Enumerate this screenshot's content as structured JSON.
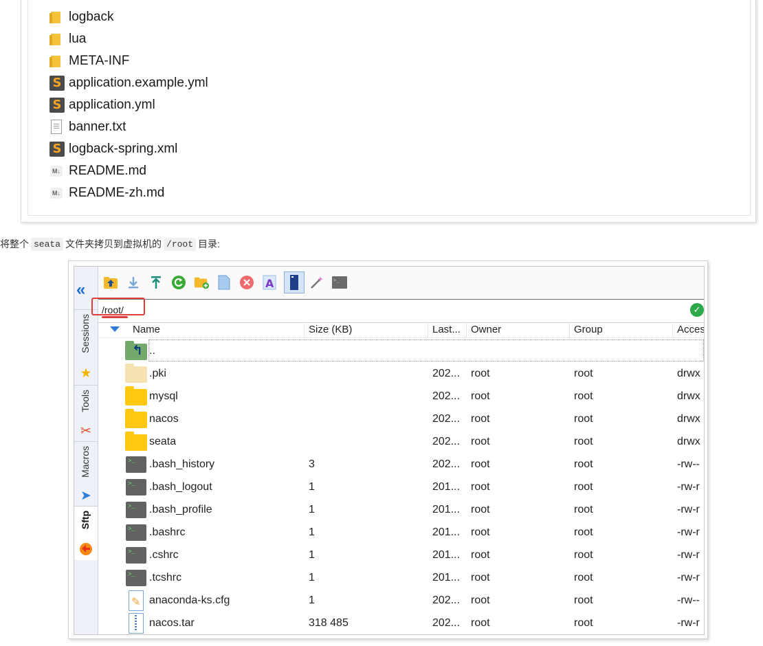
{
  "explorer": {
    "files": [
      {
        "name": "logback",
        "icon": "folder-icon"
      },
      {
        "name": "lua",
        "icon": "folder-icon"
      },
      {
        "name": "META-INF",
        "icon": "folder-icon"
      },
      {
        "name": "application.example.yml",
        "icon": "sublime-file-icon"
      },
      {
        "name": "application.yml",
        "icon": "sublime-file-icon"
      },
      {
        "name": "banner.txt",
        "icon": "text-file-icon"
      },
      {
        "name": "logback-spring.xml",
        "icon": "sublime-file-icon"
      },
      {
        "name": "README.md",
        "icon": "markdown-file-icon"
      },
      {
        "name": "README-zh.md",
        "icon": "markdown-file-icon"
      }
    ]
  },
  "caption": {
    "part1": "将整个",
    "code1": "seata",
    "part2": "文件夹拷贝到虚拟机的",
    "code2": "/root",
    "part3": "目录:"
  },
  "sidebar": {
    "tabs": [
      {
        "label": "Sessions",
        "icon": "star-icon"
      },
      {
        "label": "Tools",
        "icon": "tools-icon"
      },
      {
        "label": "Macros",
        "icon": "paper-plane-icon"
      },
      {
        "label": "Sftp",
        "icon": "sftp-icon",
        "active": true
      }
    ]
  },
  "toolbar": {
    "buttons": [
      "parent-folder-icon",
      "download-icon",
      "upload-icon",
      "refresh-icon",
      "new-folder-icon",
      "new-file-icon",
      "delete-icon",
      "rename-icon",
      "toggle-panel-icon",
      "magic-wand-icon",
      "terminal-icon"
    ]
  },
  "path": {
    "value": "/root/"
  },
  "columns": {
    "name": "Name",
    "size": "Size (KB)",
    "last": "Last...",
    "owner": "Owner",
    "group": "Group",
    "access": "Access"
  },
  "rows": [
    {
      "name": "..",
      "size": "",
      "last": "",
      "owner": "",
      "group": "",
      "access": "",
      "kind": "up"
    },
    {
      "name": ".pki",
      "size": "",
      "last": "202...",
      "owner": "root",
      "group": "root",
      "access": "drwx",
      "kind": "dir-pale"
    },
    {
      "name": "mysql",
      "size": "",
      "last": "202...",
      "owner": "root",
      "group": "root",
      "access": "drwx",
      "kind": "dir"
    },
    {
      "name": "nacos",
      "size": "",
      "last": "202...",
      "owner": "root",
      "group": "root",
      "access": "drwx",
      "kind": "dir"
    },
    {
      "name": "seata",
      "size": "",
      "last": "202...",
      "owner": "root",
      "group": "root",
      "access": "drwx",
      "kind": "dir"
    },
    {
      "name": ".bash_history",
      "size": "3",
      "last": "202...",
      "owner": "root",
      "group": "root",
      "access": "-rw--",
      "kind": "term"
    },
    {
      "name": ".bash_logout",
      "size": "1",
      "last": "201...",
      "owner": "root",
      "group": "root",
      "access": "-rw-r",
      "kind": "term"
    },
    {
      "name": ".bash_profile",
      "size": "1",
      "last": "201...",
      "owner": "root",
      "group": "root",
      "access": "-rw-r",
      "kind": "term"
    },
    {
      "name": ".bashrc",
      "size": "1",
      "last": "201...",
      "owner": "root",
      "group": "root",
      "access": "-rw-r",
      "kind": "term"
    },
    {
      "name": ".cshrc",
      "size": "1",
      "last": "201...",
      "owner": "root",
      "group": "root",
      "access": "-rw-r",
      "kind": "term"
    },
    {
      "name": ".tcshrc",
      "size": "1",
      "last": "201...",
      "owner": "root",
      "group": "root",
      "access": "-rw-r",
      "kind": "term"
    },
    {
      "name": "anaconda-ks.cfg",
      "size": "1",
      "last": "202...",
      "owner": "root",
      "group": "root",
      "access": "-rw--",
      "kind": "cfg"
    },
    {
      "name": "nacos.tar",
      "size": "318 485",
      "last": "202...",
      "owner": "root",
      "group": "root",
      "access": "-rw-r",
      "kind": "zip"
    }
  ]
}
